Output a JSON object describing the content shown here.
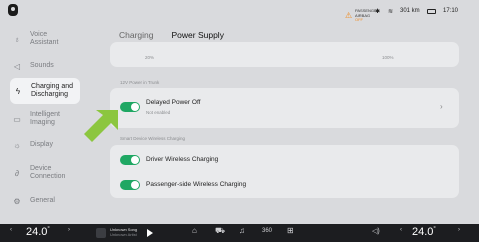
{
  "status": {
    "airbag_line1": "PASSENGER",
    "airbag_line2_prefix": "AIRBAG",
    "airbag_line2_state": "OFF",
    "range": "301 km",
    "time": "17:10"
  },
  "sidebar": {
    "items": [
      {
        "label": "Voice\nAssistant",
        "icon": "microphone-icon"
      },
      {
        "label": "Sounds",
        "icon": "speaker-icon"
      },
      {
        "label": "Charging and\nDischarging",
        "icon": "charging-icon"
      },
      {
        "label": "Intelligent\nImaging",
        "icon": "camera-icon"
      },
      {
        "label": "Display",
        "icon": "brightness-icon"
      },
      {
        "label": "Device\nConnection",
        "icon": "link-icon"
      },
      {
        "label": "General",
        "icon": "gear-icon"
      }
    ]
  },
  "tabs": [
    "Charging",
    "Power Supply"
  ],
  "main": {
    "range_left": "20%",
    "range_right": "100%",
    "section_truck": "12V Power in Trunk",
    "delayed_title": "Delayed Power Off",
    "delayed_sub": "Not enabled",
    "section_wireless": "Smart Device Wireless Charging",
    "driver_wireless": "Driver Wireless Charging",
    "passenger_wireless": "Passenger-side Wireless Charging"
  },
  "bottom": {
    "temp_left": "24.0",
    "temp_right": "24.0",
    "media_title": "Unknown Song",
    "media_artist": "Unknown Artist",
    "icon_360": "360"
  },
  "colors": {
    "accent": "#1fa763",
    "arrow": "#8cc63f",
    "airbag": "#f08a1f"
  }
}
